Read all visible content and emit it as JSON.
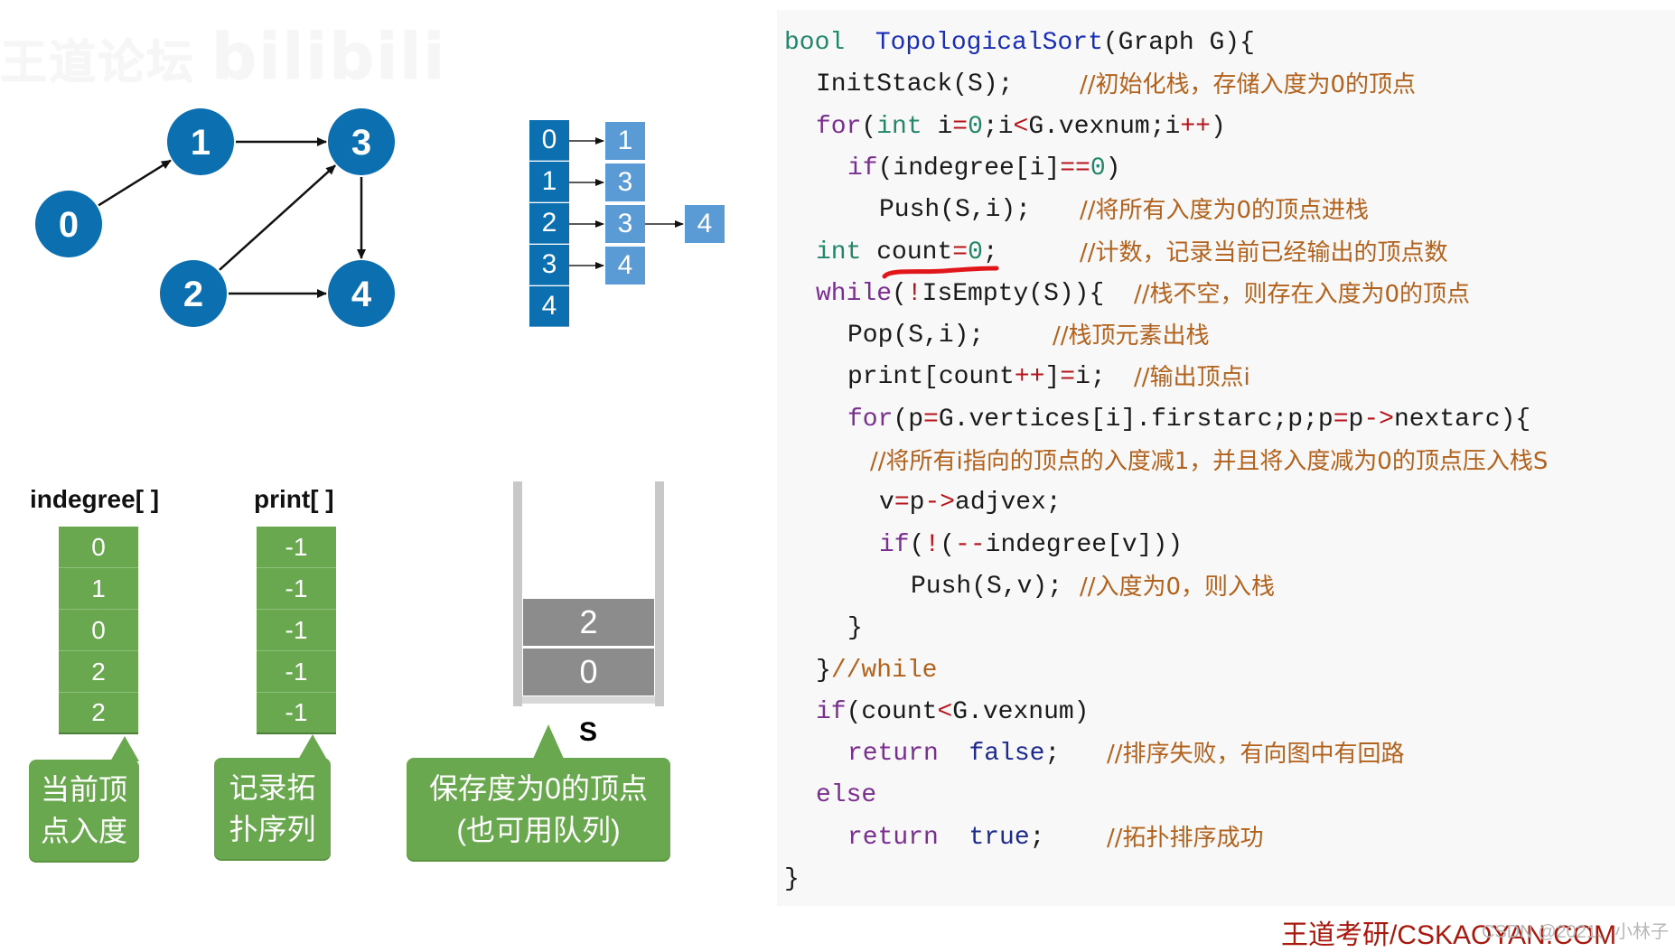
{
  "watermark": {
    "text": "王道论坛",
    "logo": "bilibili"
  },
  "graph": {
    "nodes": [
      {
        "id": "0",
        "label": "0"
      },
      {
        "id": "1",
        "label": "1"
      },
      {
        "id": "2",
        "label": "2"
      },
      {
        "id": "3",
        "label": "3"
      },
      {
        "id": "4",
        "label": "4"
      }
    ],
    "edges": [
      {
        "from": "0",
        "to": "1"
      },
      {
        "from": "1",
        "to": "3"
      },
      {
        "from": "2",
        "to": "3"
      },
      {
        "from": "2",
        "to": "4"
      },
      {
        "from": "3",
        "to": "4"
      }
    ],
    "node_color": "#0b6fb0"
  },
  "adjacency_list": {
    "vertices": [
      "0",
      "1",
      "2",
      "3",
      "4"
    ],
    "lists": [
      [
        "1"
      ],
      [
        "3"
      ],
      [
        "3",
        "4"
      ],
      [
        "4"
      ],
      []
    ],
    "vertex_color": "#0b6fb0",
    "node_color": "#5b9bd5"
  },
  "indegree": {
    "title": "indegree[ ]",
    "values": [
      "0",
      "1",
      "0",
      "2",
      "2"
    ],
    "callout_lines": [
      "当前顶",
      "点入度"
    ]
  },
  "print": {
    "title": "print[ ]",
    "values": [
      "-1",
      "-1",
      "-1",
      "-1",
      "-1"
    ],
    "callout_lines": [
      "记录拓",
      "扑序列"
    ]
  },
  "stack": {
    "label": "S",
    "items_top_to_bottom": [
      "2",
      "0"
    ],
    "callout_lines": [
      "保存度为0的顶点",
      "(也可用队列)"
    ]
  },
  "code": {
    "lines": [
      {
        "indent": 0,
        "tokens": [
          [
            "t-type",
            "bool"
          ],
          [
            "",
            "  "
          ],
          [
            "t-fn",
            "TopologicalSort"
          ],
          [
            "",
            "(Graph G){"
          ]
        ],
        "comment": ""
      },
      {
        "indent": 1,
        "tokens": [
          [
            "",
            "InitStack(S);"
          ]
        ],
        "comment": "//初始化栈，存储入度为0的顶点"
      },
      {
        "indent": 1,
        "tokens": [
          [
            "t-kw",
            "for"
          ],
          [
            "",
            "("
          ],
          [
            "t-type",
            "int"
          ],
          [
            "",
            " i"
          ],
          [
            "t-op",
            "="
          ],
          [
            "t-num",
            "0"
          ],
          [
            "",
            ";i"
          ],
          [
            "t-op",
            "<"
          ],
          [
            "",
            "G.vexnum;i"
          ],
          [
            "t-op",
            "++"
          ],
          [
            "",
            ")"
          ]
        ],
        "comment": ""
      },
      {
        "indent": 2,
        "tokens": [
          [
            "t-kw",
            "if"
          ],
          [
            "",
            "(indegree[i]"
          ],
          [
            "t-op",
            "=="
          ],
          [
            "t-num",
            "0"
          ],
          [
            "",
            ")"
          ]
        ],
        "comment": ""
      },
      {
        "indent": 3,
        "tokens": [
          [
            "",
            "Push(S,i);"
          ]
        ],
        "comment": "//将所有入度为0的顶点进栈"
      },
      {
        "indent": 1,
        "tokens": [
          [
            "t-type",
            "int"
          ],
          [
            "",
            " count"
          ],
          [
            "t-op",
            "="
          ],
          [
            "t-num",
            "0"
          ],
          [
            "",
            ";"
          ]
        ],
        "comment": "//计数，记录当前已经输出的顶点数"
      },
      {
        "indent": 1,
        "tokens": [
          [
            "t-kw",
            "while"
          ],
          [
            "",
            "("
          ],
          [
            "t-op",
            "!"
          ],
          [
            "",
            "IsEmpty(S)){"
          ]
        ],
        "comment": "//栈不空，则存在入度为0的顶点"
      },
      {
        "indent": 2,
        "tokens": [
          [
            "",
            "Pop(S,i);"
          ]
        ],
        "comment": "//栈顶元素出栈"
      },
      {
        "indent": 2,
        "tokens": [
          [
            "",
            "print[count"
          ],
          [
            "t-op",
            "++"
          ],
          [
            "",
            "]"
          ],
          [
            "t-op",
            "="
          ],
          [
            "",
            "i;"
          ]
        ],
        "comment": "//输出顶点i"
      },
      {
        "indent": 2,
        "tokens": [
          [
            "t-kw",
            "for"
          ],
          [
            "",
            "(p"
          ],
          [
            "t-op",
            "="
          ],
          [
            "",
            "G.vertices[i].firstarc;p;p"
          ],
          [
            "t-op",
            "="
          ],
          [
            "",
            "p"
          ],
          [
            "t-op",
            "->"
          ],
          [
            "",
            "nextarc){"
          ]
        ],
        "comment": ""
      },
      {
        "indent": 3,
        "tokens": [],
        "comment": "//将所有i指向的顶点的入度减1，并且将入度减为0的顶点压入栈S"
      },
      {
        "indent": 3,
        "tokens": [
          [
            "",
            "v"
          ],
          [
            "t-op",
            "="
          ],
          [
            "",
            "p"
          ],
          [
            "t-op",
            "->"
          ],
          [
            "",
            "adjvex;"
          ]
        ],
        "comment": ""
      },
      {
        "indent": 3,
        "tokens": [
          [
            "t-kw",
            "if"
          ],
          [
            "",
            "("
          ],
          [
            "t-op",
            "!"
          ],
          [
            "",
            "("
          ],
          [
            "t-op",
            "--"
          ],
          [
            "",
            "indegree[v]))"
          ]
        ],
        "comment": ""
      },
      {
        "indent": 4,
        "tokens": [
          [
            "",
            "Push(S,v);"
          ]
        ],
        "comment": "//入度为0，则入栈"
      },
      {
        "indent": 2,
        "tokens": [
          [
            "",
            "}"
          ]
        ],
        "comment": ""
      },
      {
        "indent": 1,
        "tokens": [
          [
            "",
            "}"
          ],
          [
            "t-cm",
            "//while"
          ]
        ],
        "comment": ""
      },
      {
        "indent": 1,
        "tokens": [
          [
            "t-kw",
            "if"
          ],
          [
            "",
            "(count"
          ],
          [
            "t-op",
            "<"
          ],
          [
            "",
            "G.vexnum)"
          ]
        ],
        "comment": ""
      },
      {
        "indent": 2,
        "tokens": [
          [
            "t-kw",
            "return"
          ],
          [
            "",
            "  "
          ],
          [
            "t-lit",
            "false"
          ],
          [
            "",
            ";"
          ]
        ],
        "comment": "//排序失败，有向图中有回路"
      },
      {
        "indent": 1,
        "tokens": [
          [
            "t-kw",
            "else"
          ]
        ],
        "comment": ""
      },
      {
        "indent": 2,
        "tokens": [
          [
            "t-kw",
            "return"
          ],
          [
            "",
            "  "
          ],
          [
            "t-lit",
            "true"
          ],
          [
            "",
            ";"
          ]
        ],
        "comment": "//拓扑排序成功"
      },
      {
        "indent": 0,
        "tokens": [
          [
            "",
            "}"
          ]
        ],
        "comment": ""
      }
    ],
    "highlighted_line": 5,
    "highlight_color": "#e0161b"
  },
  "footer": {
    "brand": "王道考研/CSKAOYAN.COM",
    "csdn_watermark": "CSDN @2021、小林子"
  }
}
